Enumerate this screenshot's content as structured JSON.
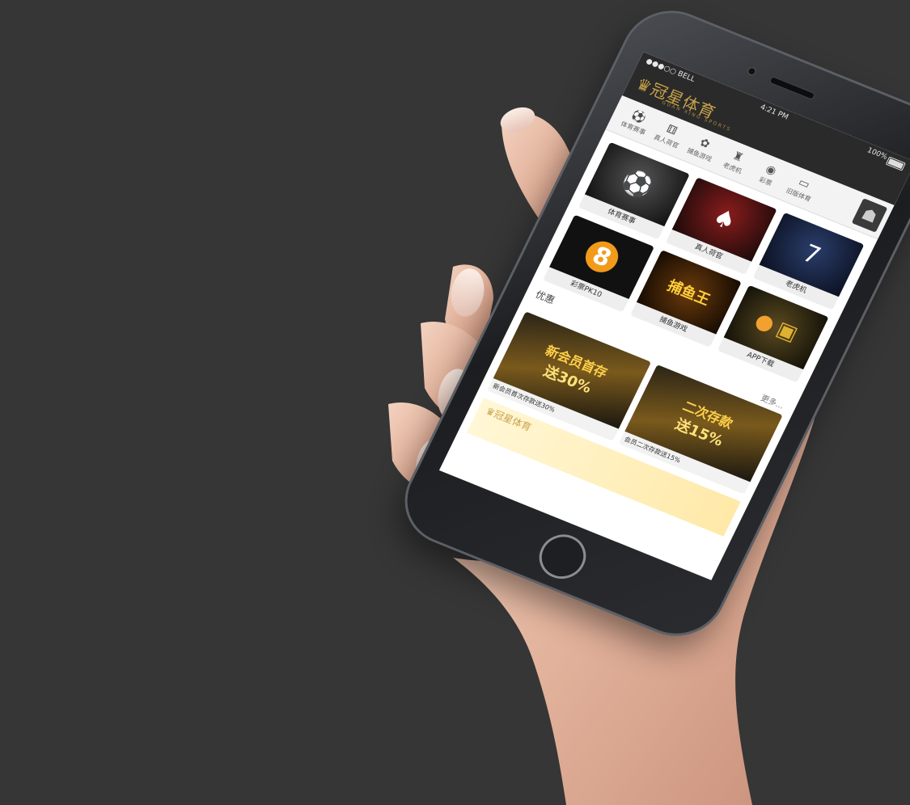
{
  "status_bar": {
    "carrier": "●●●○○ BELL",
    "time": "4:21 PM",
    "battery": "100%"
  },
  "brand": {
    "logo_text": "冠星体育",
    "logo_subtext": "GUAN XING SPORTS",
    "crown_icon": "crown-icon"
  },
  "nav": {
    "items": [
      {
        "label": "体育赛事",
        "icon": "soccer-ball-icon",
        "glyph": "⚽"
      },
      {
        "label": "真人荷官",
        "icon": "dice-icon",
        "glyph": "⚅"
      },
      {
        "label": "捕鱼游戏",
        "icon": "fish-icon",
        "glyph": "✿"
      },
      {
        "label": "老虎机",
        "icon": "slot-machine-icon",
        "glyph": "♜"
      },
      {
        "label": "彩票",
        "icon": "lottery-icon",
        "glyph": "◉"
      },
      {
        "label": "旧版体育",
        "icon": "monitor-icon",
        "glyph": "▭"
      }
    ],
    "profile_icon": "user-profile-icon"
  },
  "tiles": [
    {
      "label": "体育赛事",
      "glyph": "⚽"
    },
    {
      "label": "真人荷官",
      "glyph": "♠"
    },
    {
      "label": "老虎机",
      "glyph": "7"
    },
    {
      "label": "彩票PK10",
      "glyph": "8"
    },
    {
      "label": "捕鱼游戏",
      "glyph": "捕鱼王"
    },
    {
      "label": "APP下载",
      "glyph": ""
    }
  ],
  "promotions": {
    "title": "优惠",
    "more": "更多...",
    "items": [
      {
        "banner_line1": "新会员首存",
        "banner_line2": "送30%",
        "caption": "新会员首次存款送30%"
      },
      {
        "banner_line1": "二次存款",
        "banner_line2": "送15%",
        "caption": "会员二次存款送15%"
      }
    ]
  },
  "footer_brand": "冠星体育",
  "colors": {
    "background": "#363636",
    "gold": "#c9a24a",
    "phone_body": "#2b2c30"
  }
}
